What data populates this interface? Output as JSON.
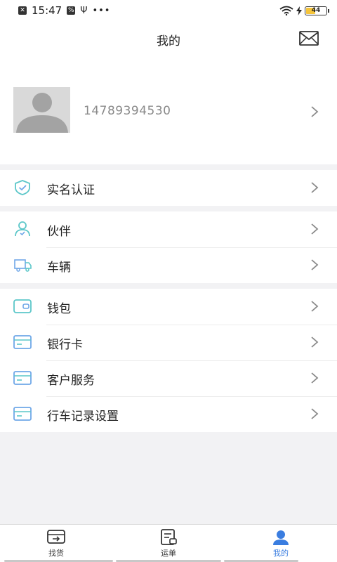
{
  "status_bar": {
    "time": "15:47",
    "battery": "44"
  },
  "header": {
    "title": "我的"
  },
  "profile": {
    "phone": "14789394530"
  },
  "menu": {
    "verify": "实名认证",
    "partner": "伙伴",
    "vehicle": "车辆",
    "wallet": "钱包",
    "bank_card": "银行卡",
    "customer_service": "客户服务",
    "trip_record": "行车记录设置"
  },
  "tabs": [
    {
      "label": "找货"
    },
    {
      "label": "运单"
    },
    {
      "label": "我的"
    }
  ],
  "colors": {
    "accent": "#3a7de0",
    "icon_teal": "#5cc7c9",
    "icon_blue": "#6fa7e8"
  }
}
